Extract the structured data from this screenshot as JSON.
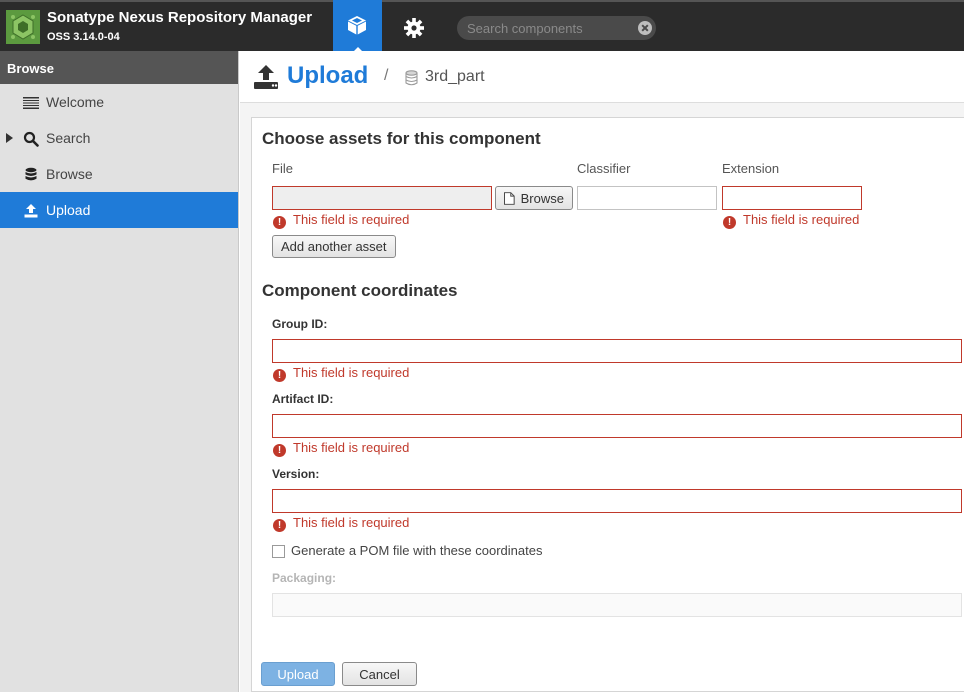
{
  "header": {
    "app_title": "Sonatype Nexus Repository Manager",
    "app_version": "OSS 3.14.0-04",
    "search_placeholder": "Search components",
    "accent_color": "#1f7bd8"
  },
  "sidebar": {
    "header": "Browse",
    "items": [
      {
        "label": "Welcome",
        "icon": "list-icon"
      },
      {
        "label": "Search",
        "icon": "search-icon"
      },
      {
        "label": "Browse",
        "icon": "database-icon"
      },
      {
        "label": "Upload",
        "icon": "upload-icon",
        "active": true
      }
    ]
  },
  "title": {
    "page": "Upload",
    "separator": "/",
    "repository": "3rd_part"
  },
  "assets": {
    "section_title": "Choose assets for this component",
    "file_label": "File",
    "classifier_label": "Classifier",
    "extension_label": "Extension",
    "file_value": "",
    "classifier_value": "",
    "extension_value": "",
    "browse_label": "Browse",
    "file_error": "This field is required",
    "extension_error": "This field is required",
    "add_asset_label": "Add another asset"
  },
  "coordinates": {
    "section_title": "Component coordinates",
    "group_label": "Group ID:",
    "group_value": "",
    "group_error": "This field is required",
    "artifact_label": "Artifact ID:",
    "artifact_value": "",
    "artifact_error": "This field is required",
    "version_label": "Version:",
    "version_value": "",
    "version_error": "This field is required",
    "generate_pom_label": "Generate a POM file with these coordinates",
    "generate_pom_checked": false,
    "packaging_label": "Packaging:",
    "packaging_value": ""
  },
  "actions": {
    "upload_label": "Upload",
    "cancel_label": "Cancel"
  }
}
